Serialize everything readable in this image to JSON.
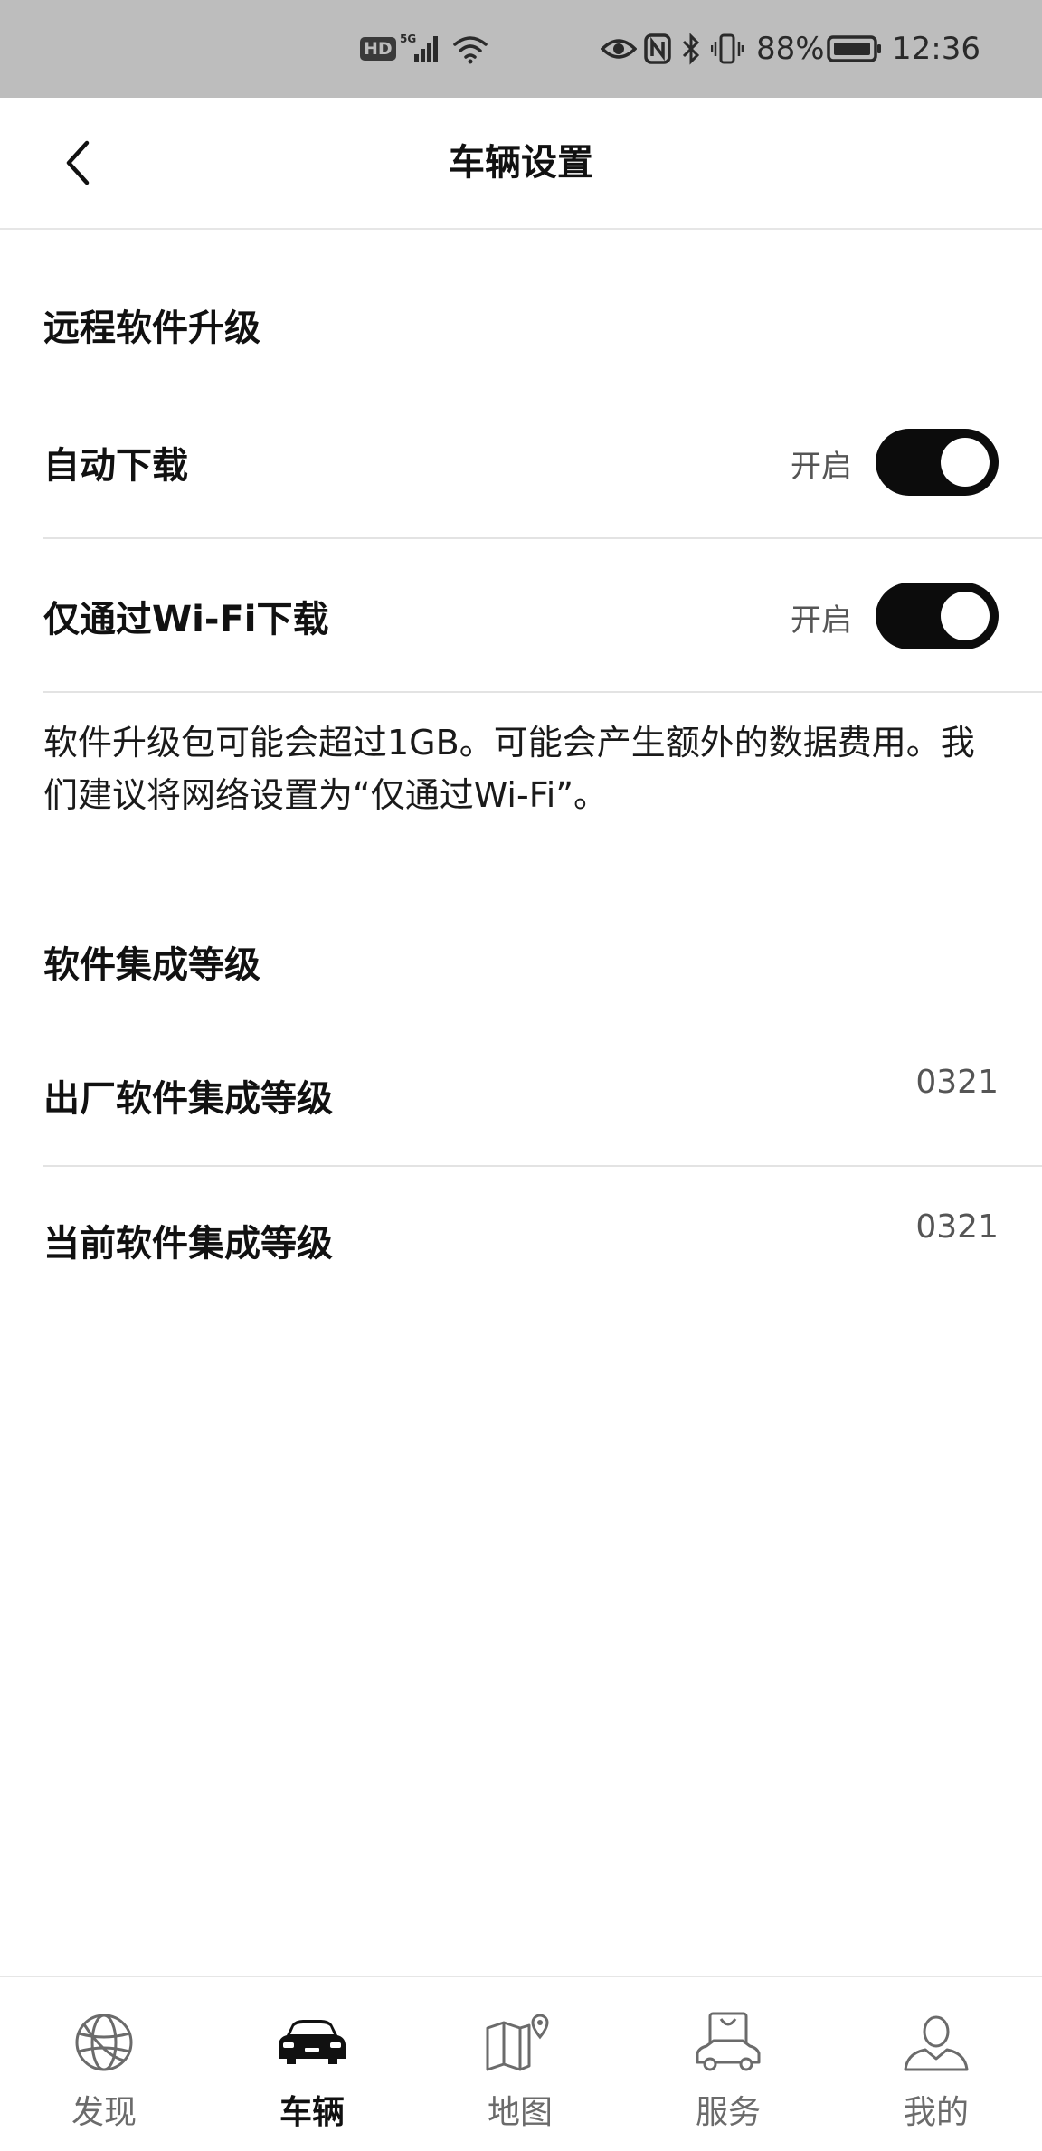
{
  "status_bar": {
    "hd": "HD",
    "network": "5G",
    "battery": "88%",
    "time": "12:36"
  },
  "header": {
    "title": "车辆设置"
  },
  "remote_upgrade": {
    "section_title": "远程软件升级",
    "auto_download": {
      "label": "自动下载",
      "state": "开启",
      "on": true
    },
    "wifi_only": {
      "label": "仅通过Wi-Fi下载",
      "state": "开启",
      "on": true
    },
    "note": "软件升级包可能会超过1GB。可能会产生额外的数据费用。我们建议将网络设置为“仅通过Wi-Fi”。"
  },
  "integration": {
    "section_title": "软件集成等级",
    "factory": {
      "label": "出厂软件集成等级",
      "value": "0321"
    },
    "current": {
      "label": "当前软件集成等级",
      "value": "0321"
    }
  },
  "bottom_nav": {
    "items": [
      {
        "label": "发现",
        "icon": "globe-icon",
        "active": false
      },
      {
        "label": "车辆",
        "icon": "car-icon",
        "active": true
      },
      {
        "label": "地图",
        "icon": "map-icon",
        "active": false
      },
      {
        "label": "服务",
        "icon": "service-bag-car-icon",
        "active": false
      },
      {
        "label": "我的",
        "icon": "user-icon",
        "active": false
      }
    ]
  },
  "colors": {
    "status_bar_bg": "#bdbdbd",
    "toggle_on": "#0c0c0c",
    "text_primary": "#111111",
    "text_secondary": "#555555",
    "nav_inactive": "#6b6b6b"
  }
}
